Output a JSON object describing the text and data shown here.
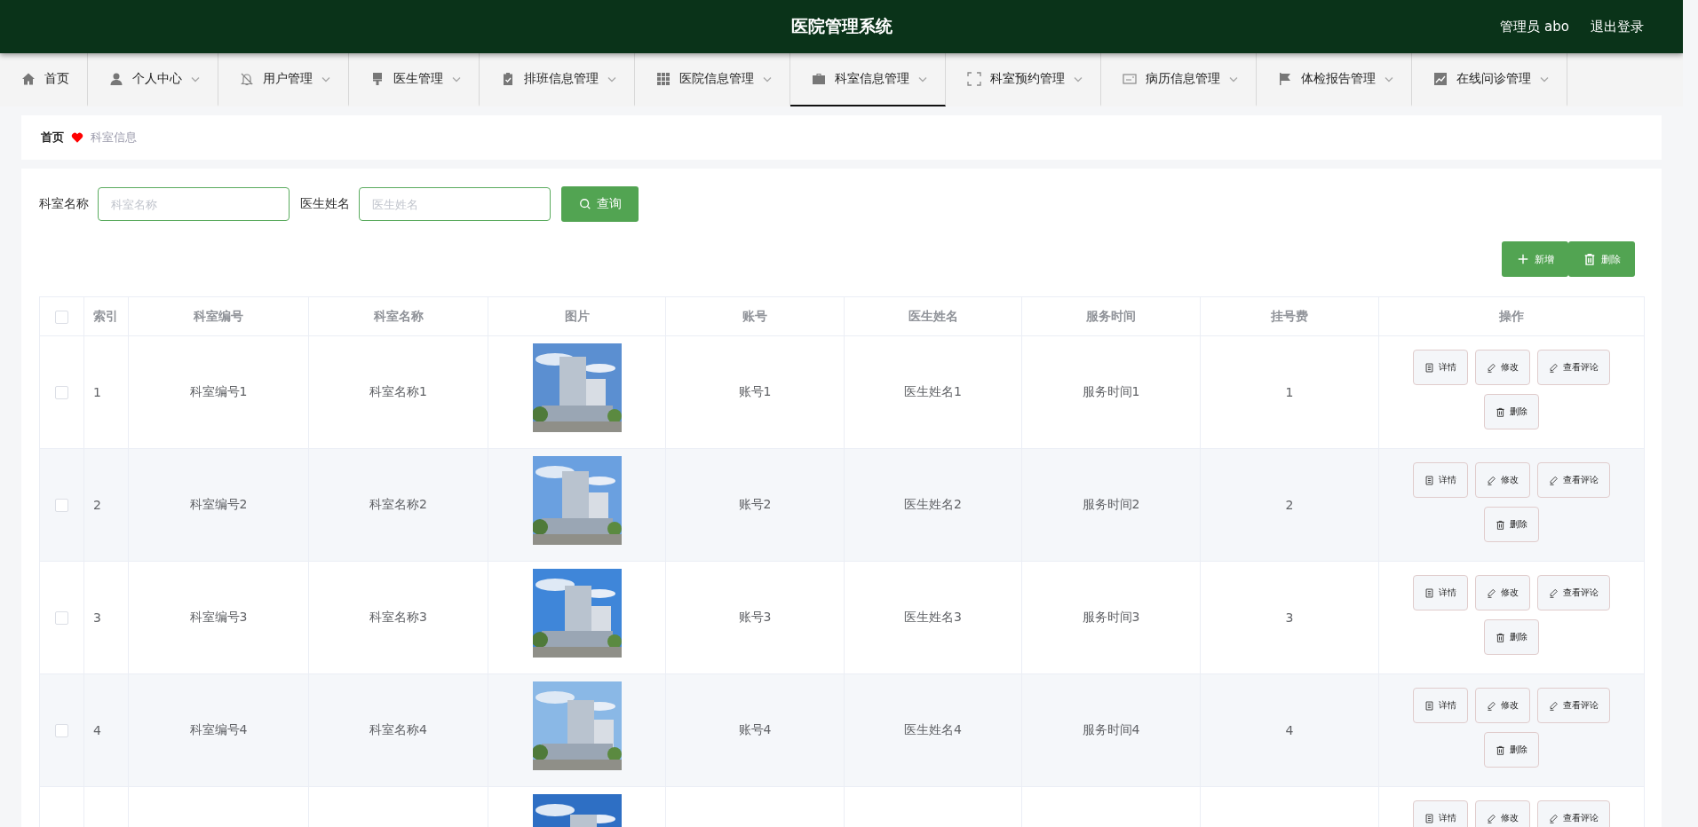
{
  "header": {
    "title": "医院管理系统",
    "user": "管理员 abo",
    "logout": "退出登录"
  },
  "nav": [
    {
      "label": "首页",
      "dropdown": false,
      "selected": false
    },
    {
      "label": "个人中心",
      "dropdown": true,
      "selected": false
    },
    {
      "label": "用户管理",
      "dropdown": true,
      "selected": false
    },
    {
      "label": "医生管理",
      "dropdown": true,
      "selected": false
    },
    {
      "label": "排班信息管理",
      "dropdown": true,
      "selected": false
    },
    {
      "label": "医院信息管理",
      "dropdown": true,
      "selected": false
    },
    {
      "label": "科室信息管理",
      "dropdown": true,
      "selected": true
    },
    {
      "label": "科室预约管理",
      "dropdown": true,
      "selected": false
    },
    {
      "label": "病历信息管理",
      "dropdown": true,
      "selected": false
    },
    {
      "label": "体检报告管理",
      "dropdown": true,
      "selected": false
    },
    {
      "label": "在线问诊管理",
      "dropdown": true,
      "selected": false
    }
  ],
  "breadcrumb": {
    "home": "首页",
    "current": "科室信息"
  },
  "search": {
    "fields": [
      {
        "label": "科室名称",
        "placeholder": "科室名称"
      },
      {
        "label": "医生姓名",
        "placeholder": "医生姓名"
      }
    ],
    "button": "查询"
  },
  "toolbar": [
    {
      "label": "新增",
      "kind": "add"
    },
    {
      "label": "删除",
      "kind": "delete"
    }
  ],
  "table": {
    "all_checked": false,
    "columns": [
      "索引",
      "科室编号",
      "科室名称",
      "图片",
      "账号",
      "医生姓名",
      "服务时间",
      "挂号费",
      "操作"
    ],
    "rows": [
      {
        "checked": false,
        "cells": [
          "1",
          "科室编号1",
          "科室名称1",
          "账号1",
          "医生姓名1",
          "服务时间1",
          "1"
        ],
        "image": {
          "kind": "picture"
        },
        "actions": [
          {
            "label": "详情",
            "kind": "detail"
          },
          {
            "label": "修改",
            "kind": "edit"
          },
          {
            "label": "查看评论",
            "kind": "edit"
          },
          {
            "label": "删除",
            "kind": "delete"
          }
        ]
      },
      {
        "checked": false,
        "cells": [
          "2",
          "科室编号2",
          "科室名称2",
          "账号2",
          "医生姓名2",
          "服务时间2",
          "2"
        ],
        "image": {
          "kind": "picture"
        },
        "actions": [
          {
            "label": "详情",
            "kind": "detail"
          },
          {
            "label": "修改",
            "kind": "edit"
          },
          {
            "label": "查看评论",
            "kind": "edit"
          },
          {
            "label": "删除",
            "kind": "delete"
          }
        ]
      },
      {
        "checked": false,
        "cells": [
          "3",
          "科室编号3",
          "科室名称3",
          "账号3",
          "医生姓名3",
          "服务时间3",
          "3"
        ],
        "image": {
          "kind": "picture"
        },
        "actions": [
          {
            "label": "详情",
            "kind": "detail"
          },
          {
            "label": "修改",
            "kind": "edit"
          },
          {
            "label": "查看评论",
            "kind": "edit"
          },
          {
            "label": "删除",
            "kind": "delete"
          }
        ]
      },
      {
        "checked": false,
        "cells": [
          "4",
          "科室编号4",
          "科室名称4",
          "账号4",
          "医生姓名4",
          "服务时间4",
          "4"
        ],
        "image": {
          "kind": "picture"
        },
        "actions": [
          {
            "label": "详情",
            "kind": "detail"
          },
          {
            "label": "修改",
            "kind": "edit"
          },
          {
            "label": "查看评论",
            "kind": "edit"
          },
          {
            "label": "删除",
            "kind": "delete"
          }
        ]
      },
      {
        "image": {
          "kind": "picture"
        },
        "actions": [
          {
            "label": "详情",
            "kind": "detail"
          },
          {
            "label": "修改",
            "kind": "edit"
          },
          {
            "label": "查看评论",
            "kind": "edit"
          }
        ]
      }
    ]
  }
}
